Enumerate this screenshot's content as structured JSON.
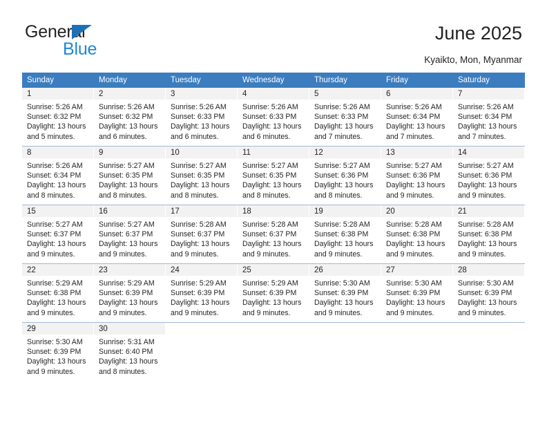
{
  "brand": {
    "name_part1": "General",
    "name_part2": "Blue",
    "color_dark": "#231f20",
    "color_blue": "#1d87d4",
    "triangle_color": "#1d70b8"
  },
  "header": {
    "title": "June 2025",
    "subtitle": "Kyaikto, Mon, Myanmar"
  },
  "theme": {
    "header_bg": "#3b7dbf",
    "header_text": "#ffffff",
    "daynum_bg": "#f2f2f2",
    "row_divider": "#9fb9d6"
  },
  "calendar": {
    "weekday_headers": [
      "Sunday",
      "Monday",
      "Tuesday",
      "Wednesday",
      "Thursday",
      "Friday",
      "Saturday"
    ],
    "weeks": [
      [
        {
          "day": "1",
          "sunrise": "Sunrise: 5:26 AM",
          "sunset": "Sunset: 6:32 PM",
          "daylight1": "Daylight: 13 hours",
          "daylight2": "and 5 minutes."
        },
        {
          "day": "2",
          "sunrise": "Sunrise: 5:26 AM",
          "sunset": "Sunset: 6:32 PM",
          "daylight1": "Daylight: 13 hours",
          "daylight2": "and 6 minutes."
        },
        {
          "day": "3",
          "sunrise": "Sunrise: 5:26 AM",
          "sunset": "Sunset: 6:33 PM",
          "daylight1": "Daylight: 13 hours",
          "daylight2": "and 6 minutes."
        },
        {
          "day": "4",
          "sunrise": "Sunrise: 5:26 AM",
          "sunset": "Sunset: 6:33 PM",
          "daylight1": "Daylight: 13 hours",
          "daylight2": "and 6 minutes."
        },
        {
          "day": "5",
          "sunrise": "Sunrise: 5:26 AM",
          "sunset": "Sunset: 6:33 PM",
          "daylight1": "Daylight: 13 hours",
          "daylight2": "and 7 minutes."
        },
        {
          "day": "6",
          "sunrise": "Sunrise: 5:26 AM",
          "sunset": "Sunset: 6:34 PM",
          "daylight1": "Daylight: 13 hours",
          "daylight2": "and 7 minutes."
        },
        {
          "day": "7",
          "sunrise": "Sunrise: 5:26 AM",
          "sunset": "Sunset: 6:34 PM",
          "daylight1": "Daylight: 13 hours",
          "daylight2": "and 7 minutes."
        }
      ],
      [
        {
          "day": "8",
          "sunrise": "Sunrise: 5:26 AM",
          "sunset": "Sunset: 6:34 PM",
          "daylight1": "Daylight: 13 hours",
          "daylight2": "and 8 minutes."
        },
        {
          "day": "9",
          "sunrise": "Sunrise: 5:27 AM",
          "sunset": "Sunset: 6:35 PM",
          "daylight1": "Daylight: 13 hours",
          "daylight2": "and 8 minutes."
        },
        {
          "day": "10",
          "sunrise": "Sunrise: 5:27 AM",
          "sunset": "Sunset: 6:35 PM",
          "daylight1": "Daylight: 13 hours",
          "daylight2": "and 8 minutes."
        },
        {
          "day": "11",
          "sunrise": "Sunrise: 5:27 AM",
          "sunset": "Sunset: 6:35 PM",
          "daylight1": "Daylight: 13 hours",
          "daylight2": "and 8 minutes."
        },
        {
          "day": "12",
          "sunrise": "Sunrise: 5:27 AM",
          "sunset": "Sunset: 6:36 PM",
          "daylight1": "Daylight: 13 hours",
          "daylight2": "and 8 minutes."
        },
        {
          "day": "13",
          "sunrise": "Sunrise: 5:27 AM",
          "sunset": "Sunset: 6:36 PM",
          "daylight1": "Daylight: 13 hours",
          "daylight2": "and 9 minutes."
        },
        {
          "day": "14",
          "sunrise": "Sunrise: 5:27 AM",
          "sunset": "Sunset: 6:36 PM",
          "daylight1": "Daylight: 13 hours",
          "daylight2": "and 9 minutes."
        }
      ],
      [
        {
          "day": "15",
          "sunrise": "Sunrise: 5:27 AM",
          "sunset": "Sunset: 6:37 PM",
          "daylight1": "Daylight: 13 hours",
          "daylight2": "and 9 minutes."
        },
        {
          "day": "16",
          "sunrise": "Sunrise: 5:27 AM",
          "sunset": "Sunset: 6:37 PM",
          "daylight1": "Daylight: 13 hours",
          "daylight2": "and 9 minutes."
        },
        {
          "day": "17",
          "sunrise": "Sunrise: 5:28 AM",
          "sunset": "Sunset: 6:37 PM",
          "daylight1": "Daylight: 13 hours",
          "daylight2": "and 9 minutes."
        },
        {
          "day": "18",
          "sunrise": "Sunrise: 5:28 AM",
          "sunset": "Sunset: 6:37 PM",
          "daylight1": "Daylight: 13 hours",
          "daylight2": "and 9 minutes."
        },
        {
          "day": "19",
          "sunrise": "Sunrise: 5:28 AM",
          "sunset": "Sunset: 6:38 PM",
          "daylight1": "Daylight: 13 hours",
          "daylight2": "and 9 minutes."
        },
        {
          "day": "20",
          "sunrise": "Sunrise: 5:28 AM",
          "sunset": "Sunset: 6:38 PM",
          "daylight1": "Daylight: 13 hours",
          "daylight2": "and 9 minutes."
        },
        {
          "day": "21",
          "sunrise": "Sunrise: 5:28 AM",
          "sunset": "Sunset: 6:38 PM",
          "daylight1": "Daylight: 13 hours",
          "daylight2": "and 9 minutes."
        }
      ],
      [
        {
          "day": "22",
          "sunrise": "Sunrise: 5:29 AM",
          "sunset": "Sunset: 6:38 PM",
          "daylight1": "Daylight: 13 hours",
          "daylight2": "and 9 minutes."
        },
        {
          "day": "23",
          "sunrise": "Sunrise: 5:29 AM",
          "sunset": "Sunset: 6:39 PM",
          "daylight1": "Daylight: 13 hours",
          "daylight2": "and 9 minutes."
        },
        {
          "day": "24",
          "sunrise": "Sunrise: 5:29 AM",
          "sunset": "Sunset: 6:39 PM",
          "daylight1": "Daylight: 13 hours",
          "daylight2": "and 9 minutes."
        },
        {
          "day": "25",
          "sunrise": "Sunrise: 5:29 AM",
          "sunset": "Sunset: 6:39 PM",
          "daylight1": "Daylight: 13 hours",
          "daylight2": "and 9 minutes."
        },
        {
          "day": "26",
          "sunrise": "Sunrise: 5:30 AM",
          "sunset": "Sunset: 6:39 PM",
          "daylight1": "Daylight: 13 hours",
          "daylight2": "and 9 minutes."
        },
        {
          "day": "27",
          "sunrise": "Sunrise: 5:30 AM",
          "sunset": "Sunset: 6:39 PM",
          "daylight1": "Daylight: 13 hours",
          "daylight2": "and 9 minutes."
        },
        {
          "day": "28",
          "sunrise": "Sunrise: 5:30 AM",
          "sunset": "Sunset: 6:39 PM",
          "daylight1": "Daylight: 13 hours",
          "daylight2": "and 9 minutes."
        }
      ],
      [
        {
          "day": "29",
          "sunrise": "Sunrise: 5:30 AM",
          "sunset": "Sunset: 6:39 PM",
          "daylight1": "Daylight: 13 hours",
          "daylight2": "and 9 minutes."
        },
        {
          "day": "30",
          "sunrise": "Sunrise: 5:31 AM",
          "sunset": "Sunset: 6:40 PM",
          "daylight1": "Daylight: 13 hours",
          "daylight2": "and 8 minutes."
        },
        {
          "day": "",
          "sunrise": "",
          "sunset": "",
          "daylight1": "",
          "daylight2": ""
        },
        {
          "day": "",
          "sunrise": "",
          "sunset": "",
          "daylight1": "",
          "daylight2": ""
        },
        {
          "day": "",
          "sunrise": "",
          "sunset": "",
          "daylight1": "",
          "daylight2": ""
        },
        {
          "day": "",
          "sunrise": "",
          "sunset": "",
          "daylight1": "",
          "daylight2": ""
        },
        {
          "day": "",
          "sunrise": "",
          "sunset": "",
          "daylight1": "",
          "daylight2": ""
        }
      ]
    ]
  }
}
